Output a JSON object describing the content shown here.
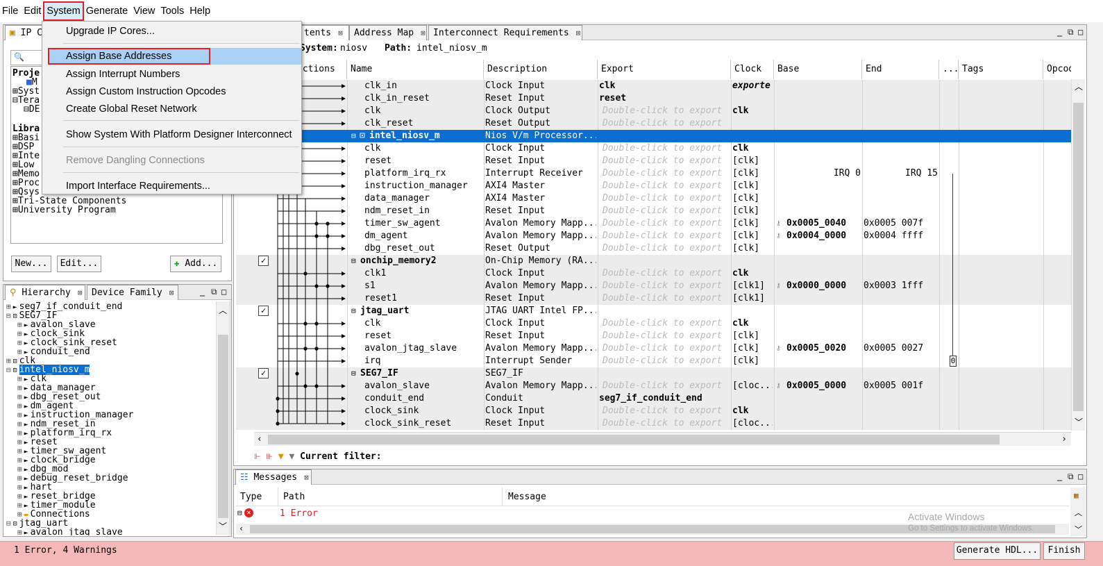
{
  "menubar": {
    "items": [
      "File",
      "Edit",
      "System",
      "Generate",
      "View",
      "Tools",
      "Help"
    ]
  },
  "system_menu": {
    "items": [
      "Upgrade IP Cores...",
      "Assign Base Addresses",
      "Assign Interrupt Numbers",
      "Assign Custom Instruction Opcodes",
      "Create Global Reset Network",
      "Show System With Platform Designer Interconnect",
      "Remove Dangling Connections",
      "Import Interface Requirements..."
    ]
  },
  "ip_catalog": {
    "tab_label": "IP C",
    "tree": [
      "Proje",
      "M",
      "Syst",
      "Tera",
      "DE",
      "Libra",
      "Basi",
      "DSP",
      "Inte",
      "Low",
      "Memo",
      "Proc",
      "Qsys",
      "Tri-State Components",
      "University Program"
    ],
    "new_button": "New...",
    "edit_button": "Edit...",
    "add_button": "Add..."
  },
  "hierarchy": {
    "tab_label": "Hierarchy",
    "tab2_label": "Device Family",
    "items": [
      {
        "text": "seg7_if_conduit_end",
        "indent": 0
      },
      {
        "text": "SEG7_IF",
        "indent": 0
      },
      {
        "text": "avalon_slave",
        "indent": 1
      },
      {
        "text": "clock_sink",
        "indent": 1
      },
      {
        "text": "clock_sink_reset",
        "indent": 1
      },
      {
        "text": "conduit_end",
        "indent": 1
      },
      {
        "text": "clk",
        "indent": 0
      },
      {
        "text": "intel_niosv_m",
        "indent": 0
      },
      {
        "text": "clk",
        "indent": 1
      },
      {
        "text": "data_manager",
        "indent": 1
      },
      {
        "text": "dbg_reset_out",
        "indent": 1
      },
      {
        "text": "dm_agent",
        "indent": 1
      },
      {
        "text": "instruction_manager",
        "indent": 1
      },
      {
        "text": "ndm_reset_in",
        "indent": 1
      },
      {
        "text": "platform_irq_rx",
        "indent": 1
      },
      {
        "text": "reset",
        "indent": 1
      },
      {
        "text": "timer_sw_agent",
        "indent": 1
      },
      {
        "text": "clock_bridge",
        "indent": 1
      },
      {
        "text": "dbg_mod",
        "indent": 1
      },
      {
        "text": "debug_reset_bridge",
        "indent": 1
      },
      {
        "text": "hart",
        "indent": 1
      },
      {
        "text": "reset_bridge",
        "indent": 1
      },
      {
        "text": "timer_module",
        "indent": 1
      },
      {
        "text": "Connections",
        "indent": 1
      },
      {
        "text": "jtag_uart",
        "indent": 0
      },
      {
        "text": "avalon_jtag_slave",
        "indent": 1
      }
    ]
  },
  "system_contents": {
    "tabs": [
      "tents",
      "Address Map",
      "Interconnect Requirements"
    ],
    "system_label": "System:",
    "system_name": "niosv",
    "path_label": "Path:",
    "path_value": "intel_niosv_m",
    "columns": [
      "ections",
      "Name",
      "Description",
      "Export",
      "Clock",
      "Base",
      "End",
      "...",
      "Tags",
      "Opcod"
    ],
    "export_hint": "Double-click to export",
    "rows": [
      {
        "name": "clk_in",
        "desc": "Clock Input",
        "export": "clk",
        "clock": "exporte",
        "base": "",
        "end": "",
        "kind": "iface",
        "hint": false,
        "group": "gray"
      },
      {
        "name": "clk_in_reset",
        "desc": "Reset Input",
        "export": "reset",
        "clock": "",
        "base": "",
        "end": "",
        "kind": "iface",
        "hint": false,
        "group": "gray"
      },
      {
        "name": "clk",
        "desc": "Clock Output",
        "export": "",
        "clock": "clk",
        "base": "",
        "end": "",
        "kind": "iface",
        "hint": true,
        "group": "gray"
      },
      {
        "name": "clk_reset",
        "desc": "Reset Output",
        "export": "",
        "clock": "",
        "base": "",
        "end": "",
        "kind": "iface",
        "hint": true,
        "group": "gray"
      },
      {
        "name": "intel_niosv_m",
        "desc": "Nios V/m Processor...",
        "export": "",
        "clock": "",
        "base": "",
        "end": "",
        "kind": "comp",
        "hint": false,
        "group": "sel"
      },
      {
        "name": "clk",
        "desc": "Clock Input",
        "export": "",
        "clock": "clk",
        "base": "",
        "end": "",
        "kind": "iface",
        "hint": true,
        "group": "white"
      },
      {
        "name": "reset",
        "desc": "Reset Input",
        "export": "",
        "clock": "[clk]",
        "base": "",
        "end": "",
        "kind": "iface",
        "hint": true,
        "group": "white"
      },
      {
        "name": "platform_irq_rx",
        "desc": "Interrupt Receiver",
        "export": "",
        "clock": "[clk]",
        "base": "IRQ 0",
        "end": "IRQ 15",
        "kind": "iface",
        "hint": true,
        "group": "white"
      },
      {
        "name": "instruction_manager",
        "desc": "AXI4 Master",
        "export": "",
        "clock": "[clk]",
        "base": "",
        "end": "",
        "kind": "iface",
        "hint": true,
        "group": "white"
      },
      {
        "name": "data_manager",
        "desc": "AXI4 Master",
        "export": "",
        "clock": "[clk]",
        "base": "",
        "end": "",
        "kind": "iface",
        "hint": true,
        "group": "white"
      },
      {
        "name": "ndm_reset_in",
        "desc": "Reset Input",
        "export": "",
        "clock": "[clk]",
        "base": "",
        "end": "",
        "kind": "iface",
        "hint": true,
        "group": "white"
      },
      {
        "name": "timer_sw_agent",
        "desc": "Avalon Memory Mapp...",
        "export": "",
        "clock": "[clk]",
        "base": "0x0005_0040",
        "end": "0x0005 007f",
        "kind": "iface",
        "hint": true,
        "group": "white"
      },
      {
        "name": "dm_agent",
        "desc": "Avalon Memory Mapp...",
        "export": "",
        "clock": "[clk]",
        "base": "0x0004_0000",
        "end": "0x0004 ffff",
        "kind": "iface",
        "hint": true,
        "group": "white"
      },
      {
        "name": "dbg_reset_out",
        "desc": "Reset Output",
        "export": "",
        "clock": "[clk]",
        "base": "",
        "end": "",
        "kind": "iface",
        "hint": true,
        "group": "white"
      },
      {
        "name": "onchip_memory2",
        "desc": "On-Chip Memory (RA...",
        "export": "",
        "clock": "",
        "base": "",
        "end": "",
        "kind": "comp",
        "hint": false,
        "group": "gray"
      },
      {
        "name": "clk1",
        "desc": "Clock Input",
        "export": "",
        "clock": "clk",
        "base": "",
        "end": "",
        "kind": "iface",
        "hint": true,
        "group": "gray"
      },
      {
        "name": "s1",
        "desc": "Avalon Memory Mapp...",
        "export": "",
        "clock": "[clk1]",
        "base": "0x0000_0000",
        "end": "0x0003 1fff",
        "kind": "iface",
        "hint": true,
        "group": "gray"
      },
      {
        "name": "reset1",
        "desc": "Reset Input",
        "export": "",
        "clock": "[clk1]",
        "base": "",
        "end": "",
        "kind": "iface",
        "hint": true,
        "group": "gray"
      },
      {
        "name": "jtag_uart",
        "desc": "JTAG UART Intel FP...",
        "export": "",
        "clock": "",
        "base": "",
        "end": "",
        "kind": "comp",
        "hint": false,
        "group": "white"
      },
      {
        "name": "clk",
        "desc": "Clock Input",
        "export": "",
        "clock": "clk",
        "base": "",
        "end": "",
        "kind": "iface",
        "hint": true,
        "group": "white"
      },
      {
        "name": "reset",
        "desc": "Reset Input",
        "export": "",
        "clock": "[clk]",
        "base": "",
        "end": "",
        "kind": "iface",
        "hint": true,
        "group": "white"
      },
      {
        "name": "avalon_jtag_slave",
        "desc": "Avalon Memory Mapp...",
        "export": "",
        "clock": "[clk]",
        "base": "0x0005_0020",
        "end": "0x0005 0027",
        "kind": "iface",
        "hint": true,
        "group": "white"
      },
      {
        "name": "irq",
        "desc": "Interrupt Sender",
        "export": "",
        "clock": "[clk]",
        "base": "",
        "end": "",
        "kind": "iface",
        "hint": true,
        "group": "white"
      },
      {
        "name": "SEG7_IF",
        "desc": "SEG7_IF",
        "export": "",
        "clock": "",
        "base": "",
        "end": "",
        "kind": "comp",
        "hint": false,
        "group": "gray"
      },
      {
        "name": "avalon_slave",
        "desc": "Avalon Memory Mapp...",
        "export": "",
        "clock": "[cloc...",
        "base": "0x0005_0000",
        "end": "0x0005 001f",
        "kind": "iface",
        "hint": true,
        "group": "gray"
      },
      {
        "name": "conduit_end",
        "desc": "Conduit",
        "export": "seg7_if_conduit_end",
        "clock": "",
        "base": "",
        "end": "",
        "kind": "iface",
        "hint": false,
        "group": "gray"
      },
      {
        "name": "clock_sink",
        "desc": "Clock Input",
        "export": "",
        "clock": "clk",
        "base": "",
        "end": "",
        "kind": "iface",
        "hint": true,
        "group": "gray"
      },
      {
        "name": "clock_sink_reset",
        "desc": "Reset Input",
        "export": "",
        "clock": "[cloc...",
        "base": "",
        "end": "",
        "kind": "iface",
        "hint": true,
        "group": "gray"
      }
    ],
    "irq_tag": "0",
    "filter_label": "Current filter:"
  },
  "messages": {
    "tab_label": "Messages",
    "columns": [
      "Type",
      "Path",
      "Message"
    ],
    "row_path": "1 Error"
  },
  "watermark": {
    "line1": "Activate Windows",
    "line2": "Go to Settings to activate Windows."
  },
  "status": {
    "text": "1 Error, 4 Warnings",
    "generate_button": "Generate HDL...",
    "finish_button": "Finish"
  },
  "colors": {
    "selection": "#0a6fd1",
    "menu_highlight": "#a9d1f5",
    "annotation_red": "#d22222",
    "error_bar": "#f5b8b8"
  }
}
